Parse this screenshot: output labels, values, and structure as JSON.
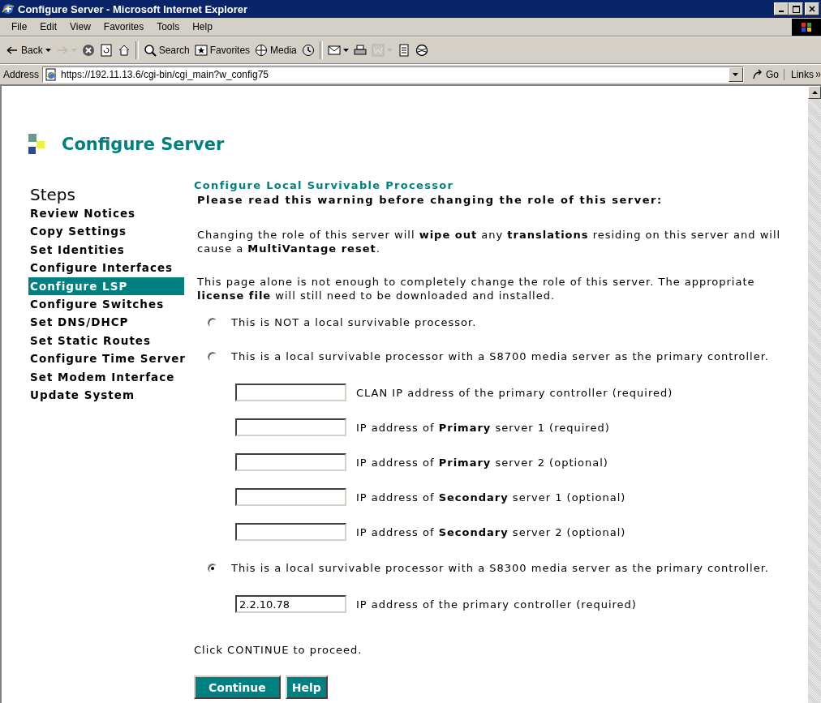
{
  "window": {
    "title": "Configure Server - Microsoft Internet Explorer"
  },
  "menu": [
    {
      "label": "File"
    },
    {
      "label": "Edit"
    },
    {
      "label": "View"
    },
    {
      "label": "Favorites"
    },
    {
      "label": "Tools"
    },
    {
      "label": "Help"
    }
  ],
  "toolbar": [
    {
      "label": "Back",
      "dropdown": true,
      "disabled": false
    },
    {
      "dropdown": true,
      "disabled": true
    },
    {
      "dropdown": false,
      "disabled": false
    },
    {
      "dropdown": false,
      "disabled": false
    },
    {
      "dropdown": false,
      "disabled": false
    },
    {
      "label": "Search",
      "dropdown": false,
      "disabled": false,
      "group_start": true
    },
    {
      "label": "Favorites",
      "dropdown": false,
      "disabled": false
    },
    {
      "label": "Media",
      "dropdown": false,
      "disabled": false
    },
    {
      "dropdown": false,
      "disabled": false
    },
    {
      "dropdown": true,
      "disabled": false,
      "group_start": true
    },
    {
      "dropdown": false,
      "disabled": false
    },
    {
      "dropdown": true,
      "disabled": true
    },
    {
      "dropdown": false,
      "disabled": false
    },
    {
      "dropdown": false,
      "disabled": false
    }
  ],
  "address": {
    "label": "Address",
    "url": "https://192.11.13.6/cgi-bin/cgi_main?w_config75",
    "go": "Go",
    "links": "Links"
  },
  "page": {
    "title": "Configure Server",
    "steps": {
      "heading": "Steps",
      "items": [
        {
          "label": "Review Notices",
          "selected": false
        },
        {
          "label": "Copy Settings",
          "selected": false
        },
        {
          "label": "Set Identities",
          "selected": false
        },
        {
          "label": "Configure Interfaces",
          "selected": false
        },
        {
          "label": "Configure LSP",
          "selected": true
        },
        {
          "label": "Configure Switches",
          "selected": false
        },
        {
          "label": "Set DNS/DHCP",
          "selected": false
        },
        {
          "label": "Set Static Routes",
          "selected": false
        },
        {
          "label": "Configure Time Server",
          "selected": false
        },
        {
          "label": "Set Modem Interface",
          "selected": false
        },
        {
          "label": "Update System",
          "selected": false
        }
      ]
    },
    "heading": "Configure Local Survivable Processor",
    "warning": "Please read this warning before changing the role of this server:",
    "paragraphs": [
      "Changing the role of this server will **wipe out** any **translations** residing on this server and will cause a **MultiVantage reset**.",
      "This page alone is not enough to completely change the role of this server. The appropriate **license file** will still need to be downloaded and installed."
    ],
    "options": [
      {
        "label": "This is NOT a local survivable processor.",
        "selected": false
      },
      {
        "label": "This is a local survivable processor with a S8700 media server as the primary controller.",
        "selected": false,
        "fields": [
          {
            "label": "CLAN IP address of the primary controller (required)"
          },
          {
            "label": "IP address of **Primary** server 1 (required)"
          },
          {
            "label": "IP address of **Primary** server 2 (optional)"
          },
          {
            "label": "IP address of **Secondary** server 1 (optional)"
          },
          {
            "label": "IP address of **Secondary** server 2 (optional)"
          }
        ]
      },
      {
        "label": "This is a local survivable processor with a S8300 media server as the primary controller.",
        "selected": true,
        "fields": [
          {
            "value": "2.2.10.78",
            "label": "IP address of the primary controller (required)"
          }
        ]
      }
    ],
    "instruction": "Click CONTINUE to proceed.",
    "buttons": [
      {
        "label": "Continue"
      },
      {
        "label": "Help"
      }
    ]
  }
}
